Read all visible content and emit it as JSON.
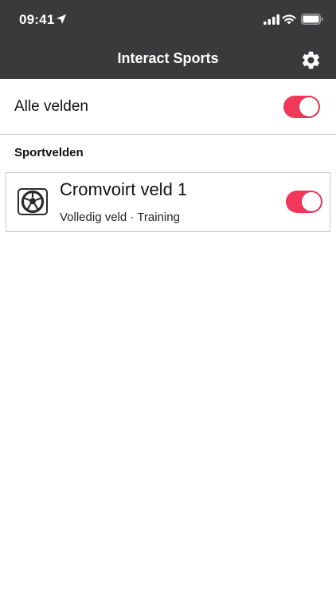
{
  "status_bar": {
    "time": "09:41",
    "icons": [
      "location-arrow-icon",
      "cellular-signal-icon",
      "wifi-icon",
      "battery-icon"
    ]
  },
  "nav": {
    "title": "Interact Sports",
    "settings_icon": "gear-icon"
  },
  "all_fields": {
    "label": "Alle velden",
    "enabled": true
  },
  "section": {
    "title": "Sportvelden"
  },
  "fields": [
    {
      "name": "Cromvoirt veld 1",
      "detail": "Volledig veld · Training",
      "icon": "soccer-ball-icon",
      "enabled": true
    }
  ],
  "colors": {
    "header_bg": "#3a3a3c",
    "toggle_on": "#f2385a",
    "divider": "#c8c8cc"
  }
}
